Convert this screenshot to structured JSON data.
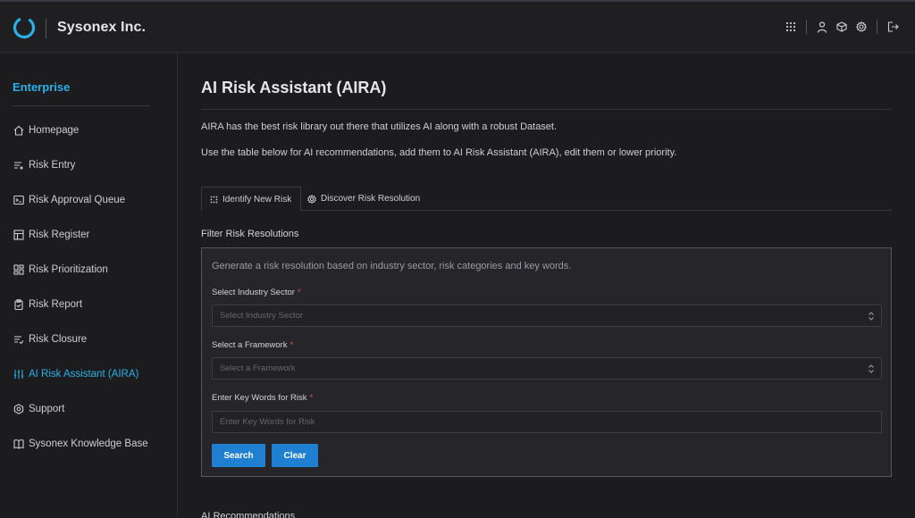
{
  "brand": {
    "name": "Sysonex Inc."
  },
  "colors": {
    "accent": "#2ab0e8",
    "button": "#1f7fd0",
    "required": "#e05555"
  },
  "top_icons": [
    "grid-icon",
    "user-icon",
    "cube-icon",
    "gear-icon",
    "logout-icon"
  ],
  "sidebar": {
    "heading": "Enterprise",
    "items": [
      {
        "label": "Homepage",
        "icon": "home-icon"
      },
      {
        "label": "Risk Entry",
        "icon": "list-add-icon"
      },
      {
        "label": "Risk Approval Queue",
        "icon": "terminal-icon"
      },
      {
        "label": "Risk Register",
        "icon": "table-icon"
      },
      {
        "label": "Risk Prioritization",
        "icon": "dashboard-icon"
      },
      {
        "label": "Risk Report",
        "icon": "clipboard-icon"
      },
      {
        "label": "Risk Closure",
        "icon": "list-check-icon"
      },
      {
        "label": "AI Risk Assistant (AIRA)",
        "icon": "sliders-icon",
        "active": true
      },
      {
        "label": "Support",
        "icon": "hexagon-icon"
      },
      {
        "label": "Sysonex Knowledge Base",
        "icon": "book-icon"
      }
    ]
  },
  "main": {
    "title": "AI Risk Assistant (AIRA)",
    "intro": "AIRA has the best risk library out there that utilizes AI along with a robust Dataset.",
    "instructions": "Use the table below for AI recommendations, add them to AI Risk Assistant (AIRA), edit them or lower priority.",
    "tabs": [
      {
        "label": "Identify New Risk",
        "icon": "dots-grid-icon",
        "active": true
      },
      {
        "label": "Discover Risk Resolution",
        "icon": "settings-icon",
        "active": false
      }
    ],
    "filter_title": "Filter Risk Resolutions",
    "filter": {
      "description": "Generate a risk resolution based on industry sector, risk categories and key words.",
      "industry": {
        "label": "Select Industry Sector",
        "required": "*",
        "placeholder": "Select Industry Sector"
      },
      "framework": {
        "label": "Select a Framework",
        "required": "*",
        "placeholder": "Select a Framework"
      },
      "keywords": {
        "label": "Enter Key Words for Risk",
        "required": "*",
        "placeholder": "Enter Key Words for Risk"
      },
      "search_label": "Search",
      "clear_label": "Clear"
    },
    "ai_recommendations_title": "AI Recommendations"
  }
}
